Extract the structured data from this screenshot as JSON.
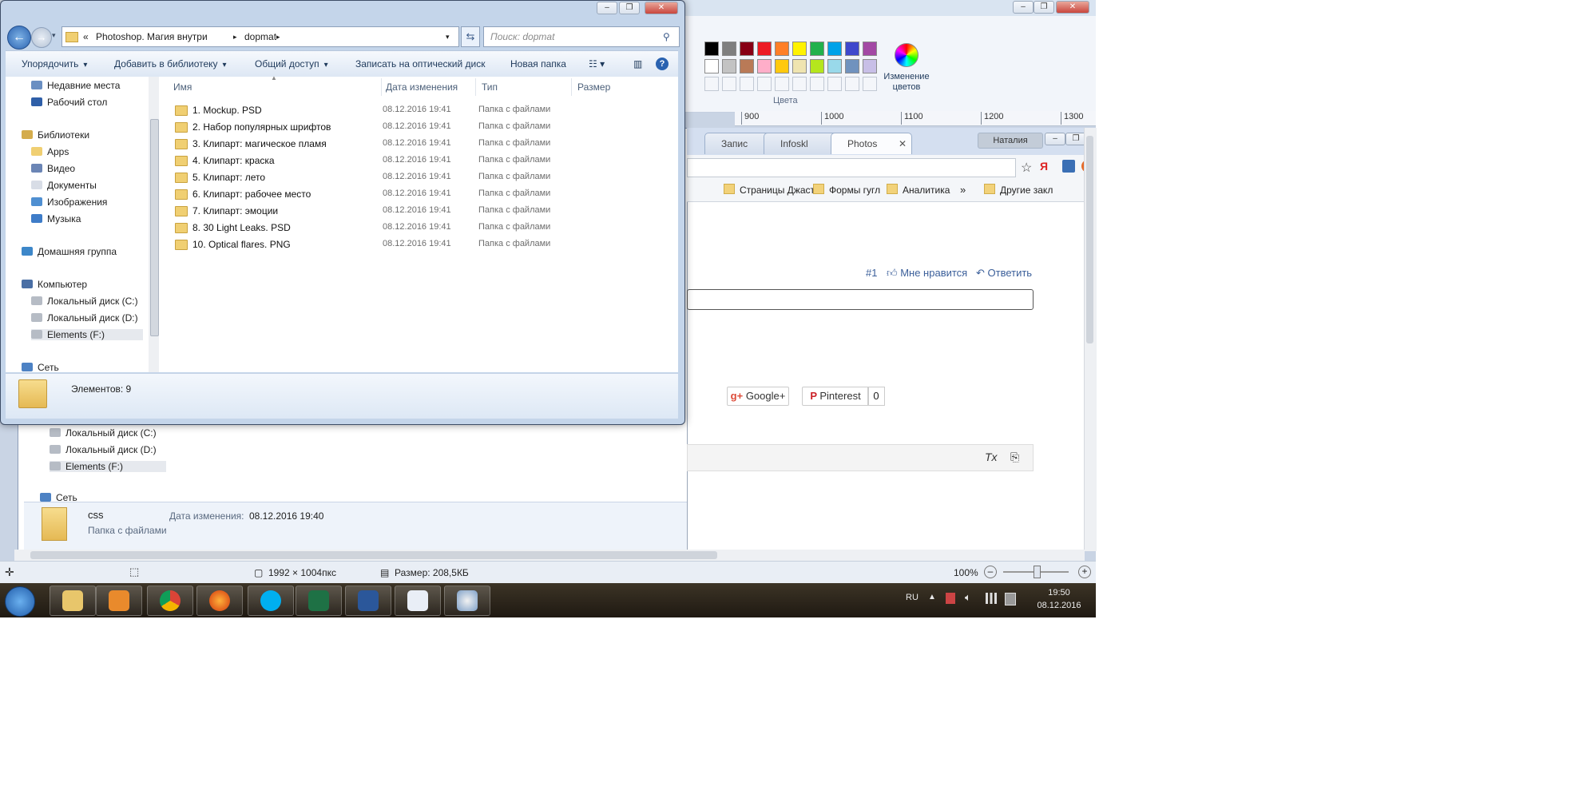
{
  "explorer": {
    "address": {
      "prefix": "«",
      "crumbs": [
        "Photoshop. Магия внутри",
        "dopmat"
      ]
    },
    "search_placeholder": "Поиск: dopmat",
    "toolbar": {
      "organize": "Упорядочить",
      "add_library": "Добавить в библиотеку",
      "share": "Общий доступ",
      "burn": "Записать на оптический диск",
      "new_folder": "Новая папка"
    },
    "nav": [
      {
        "label": "Недавние места",
        "icon": "recent-places-icon"
      },
      {
        "label": "Рабочий стол",
        "icon": "desktop-icon"
      },
      {
        "label": "Библиотеки",
        "icon": "libraries-icon"
      },
      {
        "label": "Apps",
        "icon": "folder-icon"
      },
      {
        "label": "Видео",
        "icon": "video-icon"
      },
      {
        "label": "Документы",
        "icon": "documents-icon"
      },
      {
        "label": "Изображения",
        "icon": "images-icon"
      },
      {
        "label": "Музыка",
        "icon": "music-icon"
      },
      {
        "label": "Домашняя группа",
        "icon": "homegroup-icon"
      },
      {
        "label": "Компьютер",
        "icon": "computer-icon"
      },
      {
        "label": "Локальный диск (C:)",
        "icon": "drive-icon"
      },
      {
        "label": "Локальный диск (D:)",
        "icon": "drive-icon"
      },
      {
        "label": "Elements (F:)",
        "icon": "drive-icon"
      },
      {
        "label": "Сеть",
        "icon": "network-icon"
      }
    ],
    "columns": [
      "Имя",
      "Дата изменения",
      "Тип",
      "Размер"
    ],
    "files": [
      {
        "name": "1. Mockup. PSD",
        "date": "08.12.2016 19:41",
        "type": "Папка с файлами"
      },
      {
        "name": "2. Набор популярных шрифтов",
        "date": "08.12.2016 19:41",
        "type": "Папка с файлами"
      },
      {
        "name": "3. Клипарт: магическое пламя",
        "date": "08.12.2016 19:41",
        "type": "Папка с файлами"
      },
      {
        "name": "4. Клипарт: краска",
        "date": "08.12.2016 19:41",
        "type": "Папка с файлами"
      },
      {
        "name": "5. Клипарт: лето",
        "date": "08.12.2016 19:41",
        "type": "Папка с файлами"
      },
      {
        "name": "6. Клипарт: рабочее место",
        "date": "08.12.2016 19:41",
        "type": "Папка с файлами"
      },
      {
        "name": "7. Клипарт: эмоции",
        "date": "08.12.2016 19:41",
        "type": "Папка с файлами"
      },
      {
        "name": "8. 30 Light Leaks. PSD",
        "date": "08.12.2016 19:41",
        "type": "Папка с файлами"
      },
      {
        "name": "10. Optical flares. PNG",
        "date": "08.12.2016 19:41",
        "type": "Папка с файлами"
      }
    ],
    "status": "Элементов: 9"
  },
  "back_explorer": {
    "nav": [
      "Локальный диск (C:)",
      "Локальный диск (D:)",
      "Elements (F:)",
      "Сеть"
    ],
    "details": {
      "name": "css",
      "kind": "Папка с файлами",
      "date_label": "Дата изменения:",
      "date": "08.12.2016 19:40"
    }
  },
  "paint": {
    "colors_label": "Цвета",
    "edit_colors": "Изменение цветов",
    "palette": [
      "#000000",
      "#7f7f7f",
      "#880015",
      "#ed1c24",
      "#ff7f27",
      "#fff200",
      "#22b14c",
      "#00a2e8",
      "#3f48cc",
      "#a349a4",
      "#ffffff",
      "#c3c3c3",
      "#b97a57",
      "#ffaec9",
      "#ffc90e",
      "#efe4b0",
      "#b5e61d",
      "#99d9ea",
      "#7092be",
      "#c8bfe7"
    ],
    "ruler": [
      "900",
      "1000",
      "1100",
      "1200",
      "1300"
    ],
    "status_dims": "1992 × 1004пкс",
    "status_size": "Размер: 208,5КБ",
    "zoom": "100%"
  },
  "browser": {
    "tabs": [
      "Запис",
      "Infoskl",
      "Photos"
    ],
    "user": "Наталия",
    "bookmarks": [
      "Страницы Джаста",
      "Формы гугл",
      "Аналитика",
      "Другие закл"
    ],
    "comment": {
      "num": "#1",
      "like": "Мне нравится",
      "reply": "Ответить"
    },
    "share": {
      "google": "Google+",
      "pinterest": "Pinterest",
      "pin_count": "0"
    }
  },
  "taskbar": {
    "lang": "RU",
    "time": "19:50",
    "date": "08.12.2016",
    "apps": [
      "explorer-icon",
      "media-player-icon",
      "chrome-icon",
      "firefox-icon",
      "skype-icon",
      "excel-icon",
      "word-icon",
      "notepad-icon",
      "paint-icon"
    ]
  }
}
